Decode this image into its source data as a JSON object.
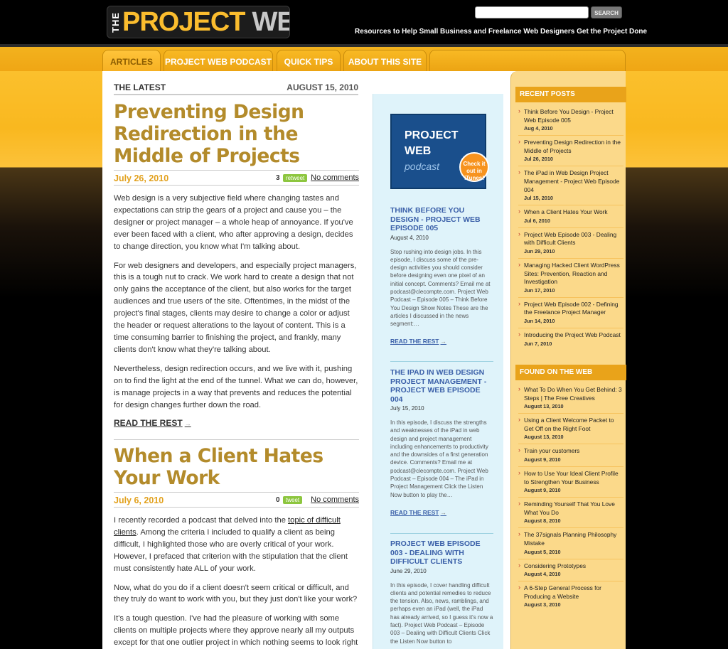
{
  "header": {
    "logo_the": "THE",
    "logo_project": "PROJECT",
    "logo_web": "WEB",
    "search_button": "SEARCH",
    "search_placeholder": "",
    "tagline": "Resources to Help Small Business and Freelance Web Designers Get the Project Done"
  },
  "nav": [
    {
      "label": "ARTICLES"
    },
    {
      "label": "PROJECT WEB PODCAST"
    },
    {
      "label": "QUICK TIPS"
    },
    {
      "label": "ABOUT THIS SITE"
    }
  ],
  "main": {
    "section_label": "THE LATEST",
    "section_date": "AUGUST 15, 2010",
    "posts": [
      {
        "title": "Preventing Design Redirection in the Middle of Projects",
        "date": "July 26, 2010",
        "count": "3",
        "share": "retweet",
        "comments": "No comments",
        "paragraphs": [
          "Web design is a very subjective field where changing tastes and expectations can strip the gears of a project and cause you – the designer or project manager – a whole heap of annoyance. If you've ever been faced with a client, who after approving a design, decides to change direction, you know what I'm talking about.",
          "For web designers and developers, and especially project managers, this is a tough nut to crack. We work hard to create a design that not only gains the acceptance of the client, but also works for the target audiences and true users of the site. Oftentimes, in the midst of the project's final stages, clients may desire to change a color or adjust the header or request alterations to the layout of content. This is a time consuming barrier to finishing the project, and frankly, many clients don't know what they're talking about.",
          "Nevertheless, design redirection occurs, and we live with it, pushing on to find the light at the end of the tunnel. What we can do, however, is manage projects in a way that prevents and reduces the potential for design changes further down the road."
        ],
        "read_more": "READ THE REST"
      },
      {
        "title": "When a Client Hates Your Work",
        "date": "July 6, 2010",
        "count": "0",
        "share": "tweet",
        "comments": "No comments",
        "p1_before": "I recently recorded a podcast that delved into the ",
        "p1_link": "topic of difficult clients",
        "p1_after": ". Among the criteria I included to qualify a client as being difficult, I highlighted those who are overly critical of your work. However, I prefaced that criterion with the stipulation that the client must consistently hate ALL of your work.",
        "p2": "Now, what do you do if a client doesn't seem critical or difficult, and they truly do want to work with you, but they just don't like your work?",
        "p3": "It's a tough question. I've had the pleasure of working with some clients on multiple projects where they approve nearly all my outputs except for that one outlier project in which nothing seems to look right"
      }
    ]
  },
  "podcast_promo": {
    "line1": "PROJECT",
    "line2": "WEB",
    "line3": "podcast",
    "badge": "Check it out in iTunes!"
  },
  "middle": [
    {
      "title": "THINK BEFORE YOU DESIGN - PROJECT WEB EPISODE 005",
      "date": "August 4, 2010",
      "excerpt": "Stop rushing into design jobs. In this episode, I discuss some of the pre-design activities you should consider before designing even one pixel of an initial concept. Comments? Email me at podcast@clecompte.com. Project Web Podcast – Episode 005 – Think Before You Design Show Notes These are the articles I discussed in the news segment:…",
      "read_more": "READ THE REST"
    },
    {
      "title": "THE IPAD IN WEB DESIGN PROJECT MANAGEMENT - PROJECT WEB EPISODE 004",
      "date": "July 15, 2010",
      "excerpt": "In this episode, I discuss the strengths and weaknesses of the iPad in web design and project management including enhancements to productivity and the downsides of a first generation device. Comments? Email me at podcast@clecompte.com. Project Web Podcast – Episode 004 – The iPad in Project Management Click the Listen Now button to play the…",
      "read_more": "READ THE REST"
    },
    {
      "title": "PROJECT WEB EPISODE 003 - DEALING WITH DIFFICULT CLIENTS",
      "date": "June 29, 2010",
      "excerpt": "In this episode, I cover handling difficult clients and potential remedies to reduce the tension. Also, news, ramblings, and perhaps even an iPad (well, the iPad has already arrived, so I guess it's now a fact). Project Web Podcast – Episode 003 – Dealing with Difficult Clients Click the Listen Now button to"
    }
  ],
  "sidebar": {
    "recent_title": "RECENT POSTS",
    "recent": [
      {
        "title": "Think Before You Design - Project Web Episode 005",
        "date": "Aug 4, 2010"
      },
      {
        "title": "Preventing Design Redirection in the Middle of Projects",
        "date": "Jul 26, 2010"
      },
      {
        "title": "The iPad in Web Design Project Management - Project Web Episode 004",
        "date": "Jul 15, 2010"
      },
      {
        "title": "When a Client Hates Your Work",
        "date": "Jul 6, 2010"
      },
      {
        "title": "Project Web Episode 003 - Dealing with Difficult Clients",
        "date": "Jun 29, 2010"
      },
      {
        "title": "Managing Hacked Client WordPress Sites: Prevention, Reaction and Investigation",
        "date": "Jun 17, 2010"
      },
      {
        "title": "Project Web Episode 002 - Defining the Freelance Project Manager",
        "date": "Jun 14, 2010"
      },
      {
        "title": "Introducing the Project Web Podcast",
        "date": "Jun 7, 2010"
      }
    ],
    "found_title": "FOUND ON THE WEB",
    "found": [
      {
        "title": "What To Do When You Get Behind: 3 Steps | The Free Creatives",
        "date": "August 13, 2010"
      },
      {
        "title": "Using a Client Welcome Packet to Get Off on the Right Foot",
        "date": "August 13, 2010"
      },
      {
        "title": "Train your customers",
        "date": "August 9, 2010"
      },
      {
        "title": "How to Use Your Ideal Client Profile to Strengthen Your Business",
        "date": "August 9, 2010"
      },
      {
        "title": "Reminding Yourself That You Love What You Do",
        "date": "August 8, 2010"
      },
      {
        "title": "The 37signals Planning Philosophy Mistake",
        "date": "August 5, 2010"
      },
      {
        "title": "Considering Prototypes",
        "date": "August 4, 2010"
      },
      {
        "title": "A 6-Step General Process for Producing a Website",
        "date": "August 3, 2010"
      }
    ]
  }
}
